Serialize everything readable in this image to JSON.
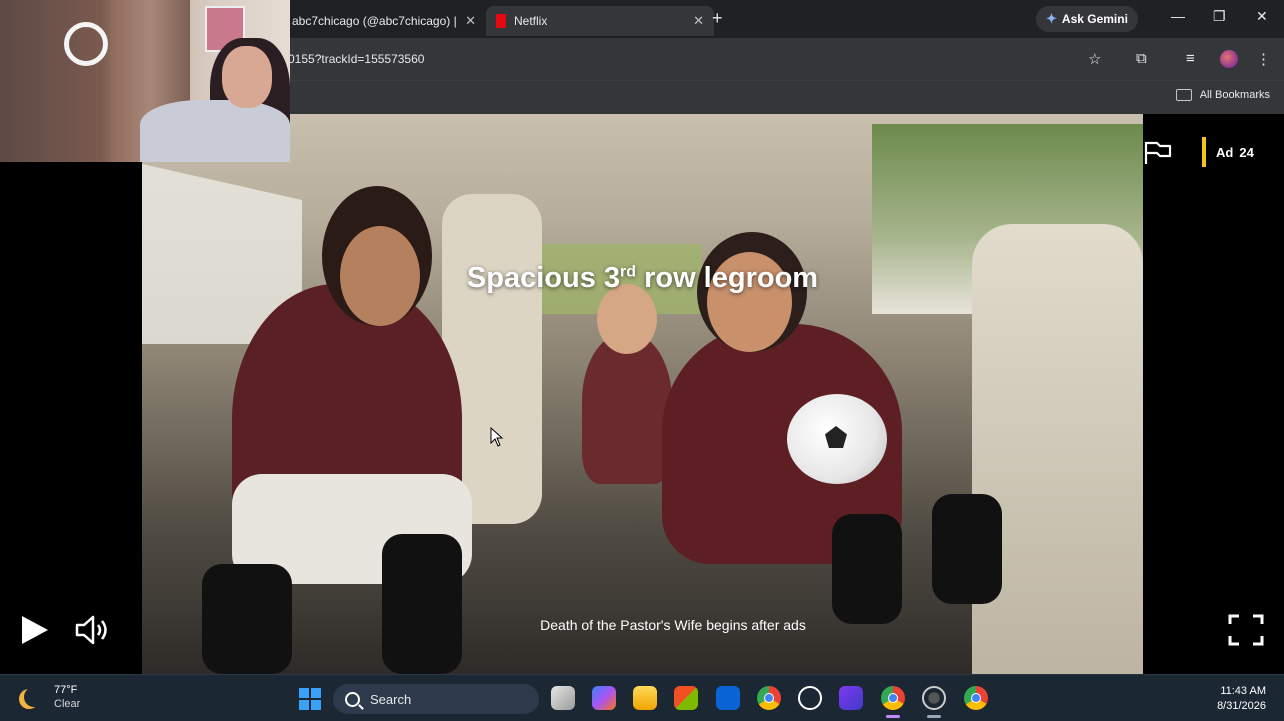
{
  "browser": {
    "tabs": [
      {
        "label": "abc7chicago (@abc7chicago) |",
        "active": false
      },
      {
        "label": "Netflix",
        "active": true
      }
    ],
    "new_tab_icon": "plus-icon",
    "ask_gemini_label": "Ask Gemini",
    "url": "0155?trackId=155573560",
    "bookmarks_label": "All Bookmarks"
  },
  "player": {
    "caption_main": "Spacious 3",
    "caption_sup": "rd",
    "caption_rest": " row legroom",
    "ad_label": "Ad",
    "ad_countdown": "24",
    "ad_message": "Death of the Pastor's Wife begins after ads",
    "accent_color": "#f5c518"
  },
  "taskbar": {
    "temperature": "77°F",
    "condition": "Clear",
    "search_label": "Search",
    "time": "11:43 AM",
    "date": "8/31/2026"
  }
}
